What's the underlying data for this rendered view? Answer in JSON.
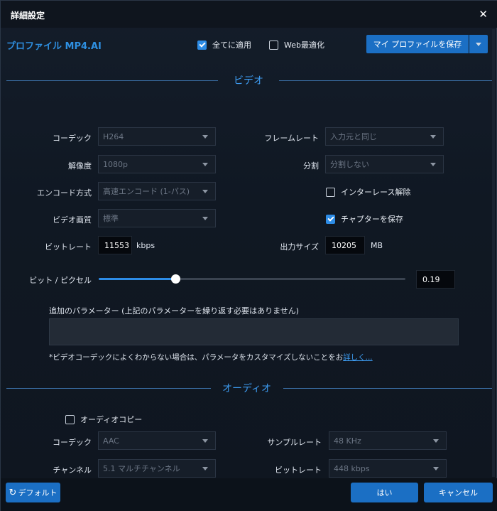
{
  "window": {
    "title": "詳細設定",
    "close_icon": "close-icon"
  },
  "profile": {
    "label": "プロファイル MP4.AI"
  },
  "options": {
    "apply_all": {
      "label": "全てに適用",
      "checked": true
    },
    "web_optimize": {
      "label": "Web最適化",
      "checked": false
    }
  },
  "save_profile": {
    "label": "マイ プロファイルを保存"
  },
  "video": {
    "section_title": "ビデオ",
    "codec": {
      "label": "コーデック",
      "value": "H264"
    },
    "framerate": {
      "label": "フレームレート",
      "value": "入力元と同じ"
    },
    "resolution": {
      "label": "解像度",
      "value": "1080p"
    },
    "split": {
      "label": "分割",
      "value": "分割しない"
    },
    "encode_mode": {
      "label": "エンコード方式",
      "value": "高速エンコード (1-パス)"
    },
    "deinterlace": {
      "label": "インターレース解除",
      "checked": false
    },
    "quality": {
      "label": "ビデオ画質",
      "value": "標準"
    },
    "save_chapters": {
      "label": "チャプターを保存",
      "checked": true
    },
    "bitrate": {
      "label": "ビットレート",
      "value": "11553",
      "unit": "kbps"
    },
    "output_size": {
      "label": "出力サイズ",
      "value": "10205",
      "unit": "MB"
    },
    "bits_per_pixel": {
      "label": "ビット / ピクセル",
      "value": "0.19",
      "slider_fraction": 0.25
    },
    "extra_params": {
      "label": "追加のパラメーター (上記のパラメーターを繰り返す必要はありません)",
      "value": ""
    },
    "note": {
      "text": "*ビデオコーデックによくわからない場合は、パラメータをカスタマイズしないことをお",
      "link": "詳しく..."
    }
  },
  "audio": {
    "section_title": "オーディオ",
    "audio_copy": {
      "label": "オーディオコピー",
      "checked": false
    },
    "codec": {
      "label": "コーデック",
      "value": "AAC"
    },
    "samplerate": {
      "label": "サンプルレート",
      "value": "48 KHz"
    },
    "channel": {
      "label": "チャンネル",
      "value": "5.1 マルチチャンネル"
    },
    "bitrate": {
      "label": "ビットレート",
      "value": "448 kbps"
    }
  },
  "footer": {
    "default_label": "デフォルト",
    "ok_label": "はい",
    "cancel_label": "キャンセル"
  },
  "colors": {
    "accent": "#2d8ce6",
    "section": "#3d9bf0",
    "background": "#101823"
  }
}
